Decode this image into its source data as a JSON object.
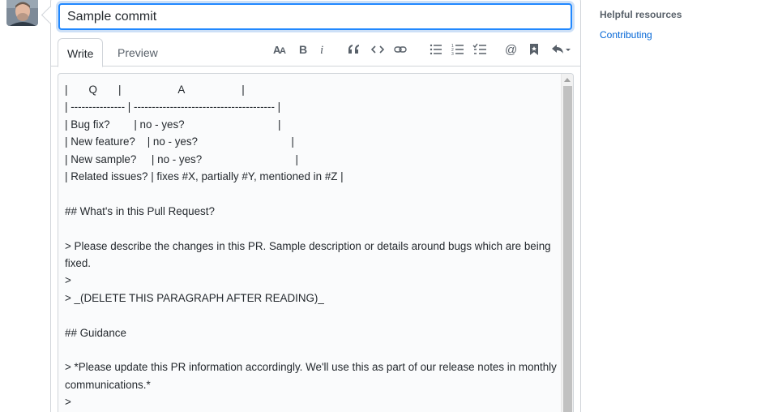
{
  "title_input": {
    "value": "Sample commit"
  },
  "tabs": {
    "write": "Write",
    "preview": "Preview"
  },
  "toolbar": {
    "icons": [
      "text-size-icon",
      "bold-icon",
      "italic-icon",
      "quote-icon",
      "code-icon",
      "link-icon",
      "unordered-list-icon",
      "ordered-list-icon",
      "task-list-icon",
      "mention-icon",
      "saved-reply-icon",
      "reply-icon"
    ]
  },
  "body_lines": [
    "|       Q       |                   A                   |",
    "| --------------- | --------------------------------------- |",
    "| Bug fix?        | no - yes?                               |",
    "| New feature?    | no - yes?                               |",
    "| New sample?     | no - yes?                               |",
    "| Related issues? | fixes #X, partially #Y, mentioned in #Z |",
    "",
    "## What's in this Pull Request?",
    "",
    "> Please describe the changes in this PR. Sample description or details around bugs which are being fixed.",
    ">",
    "> _(DELETE THIS PARAGRAPH AFTER READING)_",
    "",
    "## Guidance",
    "",
    "> *Please update this PR information accordingly. We'll use this as part of our release notes in monthly communications.*",
    ">"
  ],
  "sidebar": {
    "heading": "Helpful resources",
    "link": "Contributing"
  },
  "colors": {
    "accent": "#2188ff",
    "link": "#0366d6",
    "muted": "#586069"
  }
}
